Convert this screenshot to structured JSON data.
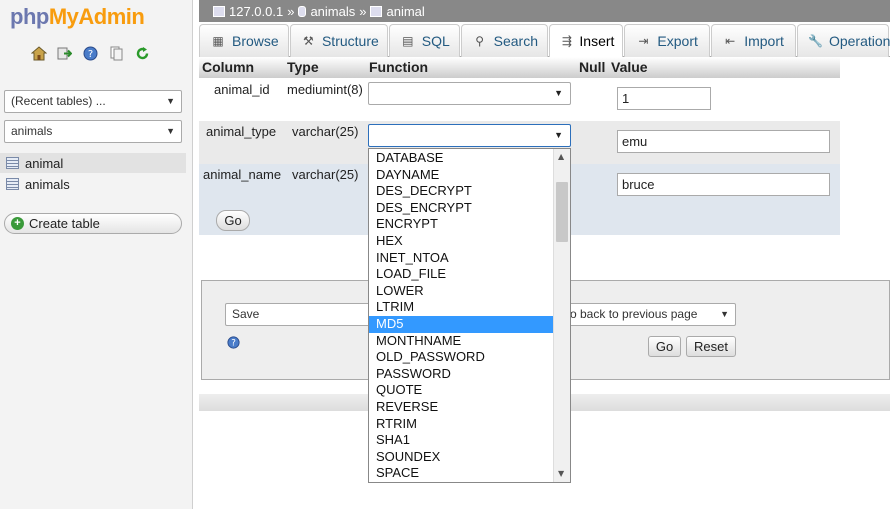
{
  "logo": {
    "php": "php",
    "myadmin": "MyAdmin"
  },
  "left_panel": {
    "recent_tables": "(Recent tables) ...",
    "database": "animals",
    "tree": [
      "animal",
      "animals"
    ],
    "create_table": "Create table"
  },
  "breadcrumb": {
    "server": "127.0.0.1",
    "sep": "»",
    "database": "animals",
    "table": "animal"
  },
  "tabs": [
    "Browse",
    "Structure",
    "SQL",
    "Search",
    "Insert",
    "Export",
    "Import",
    "Operation"
  ],
  "table_header": {
    "column": "Column",
    "type": "Type",
    "function": "Function",
    "null": "Null",
    "value": "Value"
  },
  "rows": [
    {
      "column": "animal_id",
      "type": "mediumint(8)",
      "value": "1"
    },
    {
      "column": "animal_type",
      "type": "varchar(25)",
      "value": "emu"
    },
    {
      "column": "animal_name",
      "type": "varchar(25)",
      "value": "bruce"
    }
  ],
  "go_label": "Go",
  "bottom": {
    "save_option": "Save",
    "after_option": "o back to previous page",
    "go_label": "Go",
    "reset_label": "Reset"
  },
  "function_options": [
    "DATABASE",
    "DAYNAME",
    "DES_DECRYPT",
    "DES_ENCRYPT",
    "ENCRYPT",
    "HEX",
    "INET_NTOA",
    "LOAD_FILE",
    "LOWER",
    "LTRIM",
    "MD5",
    "MONTHNAME",
    "OLD_PASSWORD",
    "PASSWORD",
    "QUOTE",
    "REVERSE",
    "RTRIM",
    "SHA1",
    "SOUNDEX",
    "SPACE"
  ],
  "highlighted_option": "MD5",
  "colors": {
    "accent": "#235a81",
    "highlight": "#3399ff",
    "row_alt": "#dfe6ee"
  }
}
